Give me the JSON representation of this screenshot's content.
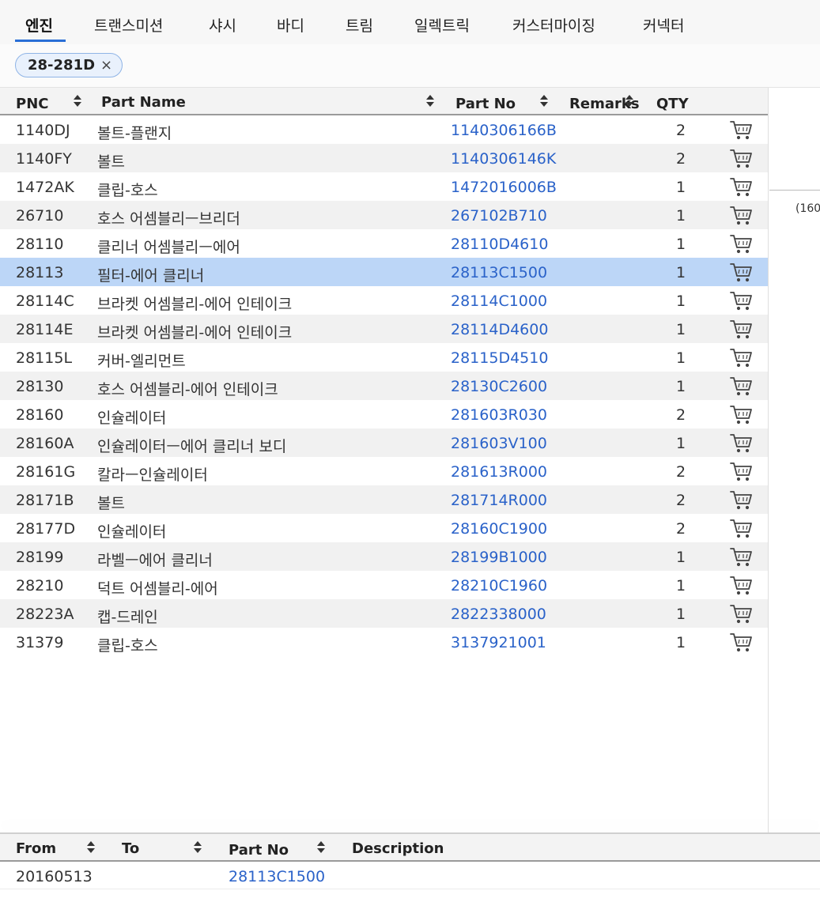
{
  "tabs": [
    "엔진",
    "트랜스미션",
    "샤시",
    "바디",
    "트림",
    "일렉트릭",
    "커스터마이징",
    "커넥터"
  ],
  "filter_chip": {
    "label": "28-281D",
    "remove_glyph": "×"
  },
  "parts_table": {
    "headers": {
      "pnc": "PNC",
      "part_name": "Part Name",
      "part_no": "Part No",
      "remarks": "Remarks",
      "qty": "QTY"
    },
    "rows": [
      {
        "pnc": "1140DJ",
        "name": "볼트-플랜지",
        "part_no": "1140306166B",
        "remarks": "",
        "qty": "2"
      },
      {
        "pnc": "1140FY",
        "name": "볼트",
        "part_no": "1140306146K",
        "remarks": "",
        "qty": "2"
      },
      {
        "pnc": "1472AK",
        "name": "클립-호스",
        "part_no": "1472016006B",
        "remarks": "",
        "qty": "1"
      },
      {
        "pnc": "26710",
        "name": "호스 어셈블리ㅡ브리더",
        "part_no": "267102B710",
        "remarks": "",
        "qty": "1"
      },
      {
        "pnc": "28110",
        "name": "클리너 어셈블리ㅡ에어",
        "part_no": "28110D4610",
        "remarks": "",
        "qty": "1"
      },
      {
        "pnc": "28113",
        "name": "필터-에어 클리너",
        "part_no": "28113C1500",
        "remarks": "",
        "qty": "1"
      },
      {
        "pnc": "28114C",
        "name": "브라켓 어셈블리-에어 인테이크",
        "part_no": "28114C1000",
        "remarks": "",
        "qty": "1"
      },
      {
        "pnc": "28114E",
        "name": "브라켓 어셈블리-에어 인테이크",
        "part_no": "28114D4600",
        "remarks": "",
        "qty": "1"
      },
      {
        "pnc": "28115L",
        "name": "커버-엘리먼트",
        "part_no": "28115D4510",
        "remarks": "",
        "qty": "1"
      },
      {
        "pnc": "28130",
        "name": "호스 어셈블리-에어 인테이크",
        "part_no": "28130C2600",
        "remarks": "",
        "qty": "1"
      },
      {
        "pnc": "28160",
        "name": "인슐레이터",
        "part_no": "281603R030",
        "remarks": "",
        "qty": "2"
      },
      {
        "pnc": "28160A",
        "name": "인슐레이터ㅡ에어 클리너 보디",
        "part_no": "281603V100",
        "remarks": "",
        "qty": "1"
      },
      {
        "pnc": "28161G",
        "name": "칼라ㅡ인슐레이터",
        "part_no": "281613R000",
        "remarks": "",
        "qty": "2"
      },
      {
        "pnc": "28171B",
        "name": "볼트",
        "part_no": "281714R000",
        "remarks": "",
        "qty": "2"
      },
      {
        "pnc": "28177D",
        "name": "인슐레이터",
        "part_no": "28160C1900",
        "remarks": "",
        "qty": "2"
      },
      {
        "pnc": "28199",
        "name": "라벨ㅡ에어 클리너",
        "part_no": "28199B1000",
        "remarks": "",
        "qty": "1"
      },
      {
        "pnc": "28210",
        "name": "덕트 어셈블리-에어",
        "part_no": "28210C1960",
        "remarks": "",
        "qty": "1"
      },
      {
        "pnc": "28223A",
        "name": "캡-드레인",
        "part_no": "2822338000",
        "remarks": "",
        "qty": "1"
      },
      {
        "pnc": "31379",
        "name": "클립-호스",
        "part_no": "3137921001",
        "remarks": "",
        "qty": "1"
      }
    ],
    "selected_pnc": "28113",
    "row_action_icon": "cart-icon"
  },
  "side_panel": {
    "text": "(160"
  },
  "detail_table": {
    "headers": {
      "from": "From",
      "to": "To",
      "part_no": "Part No",
      "description": "Description"
    },
    "rows": [
      {
        "from": "20160513",
        "to": "",
        "part_no": "28113C1500",
        "description": ""
      }
    ]
  },
  "colors": {
    "accent": "#2a6fd6",
    "link": "#2a62c9",
    "selected_row": "#bcd6f7",
    "alt_row": "#f1f1f1"
  }
}
